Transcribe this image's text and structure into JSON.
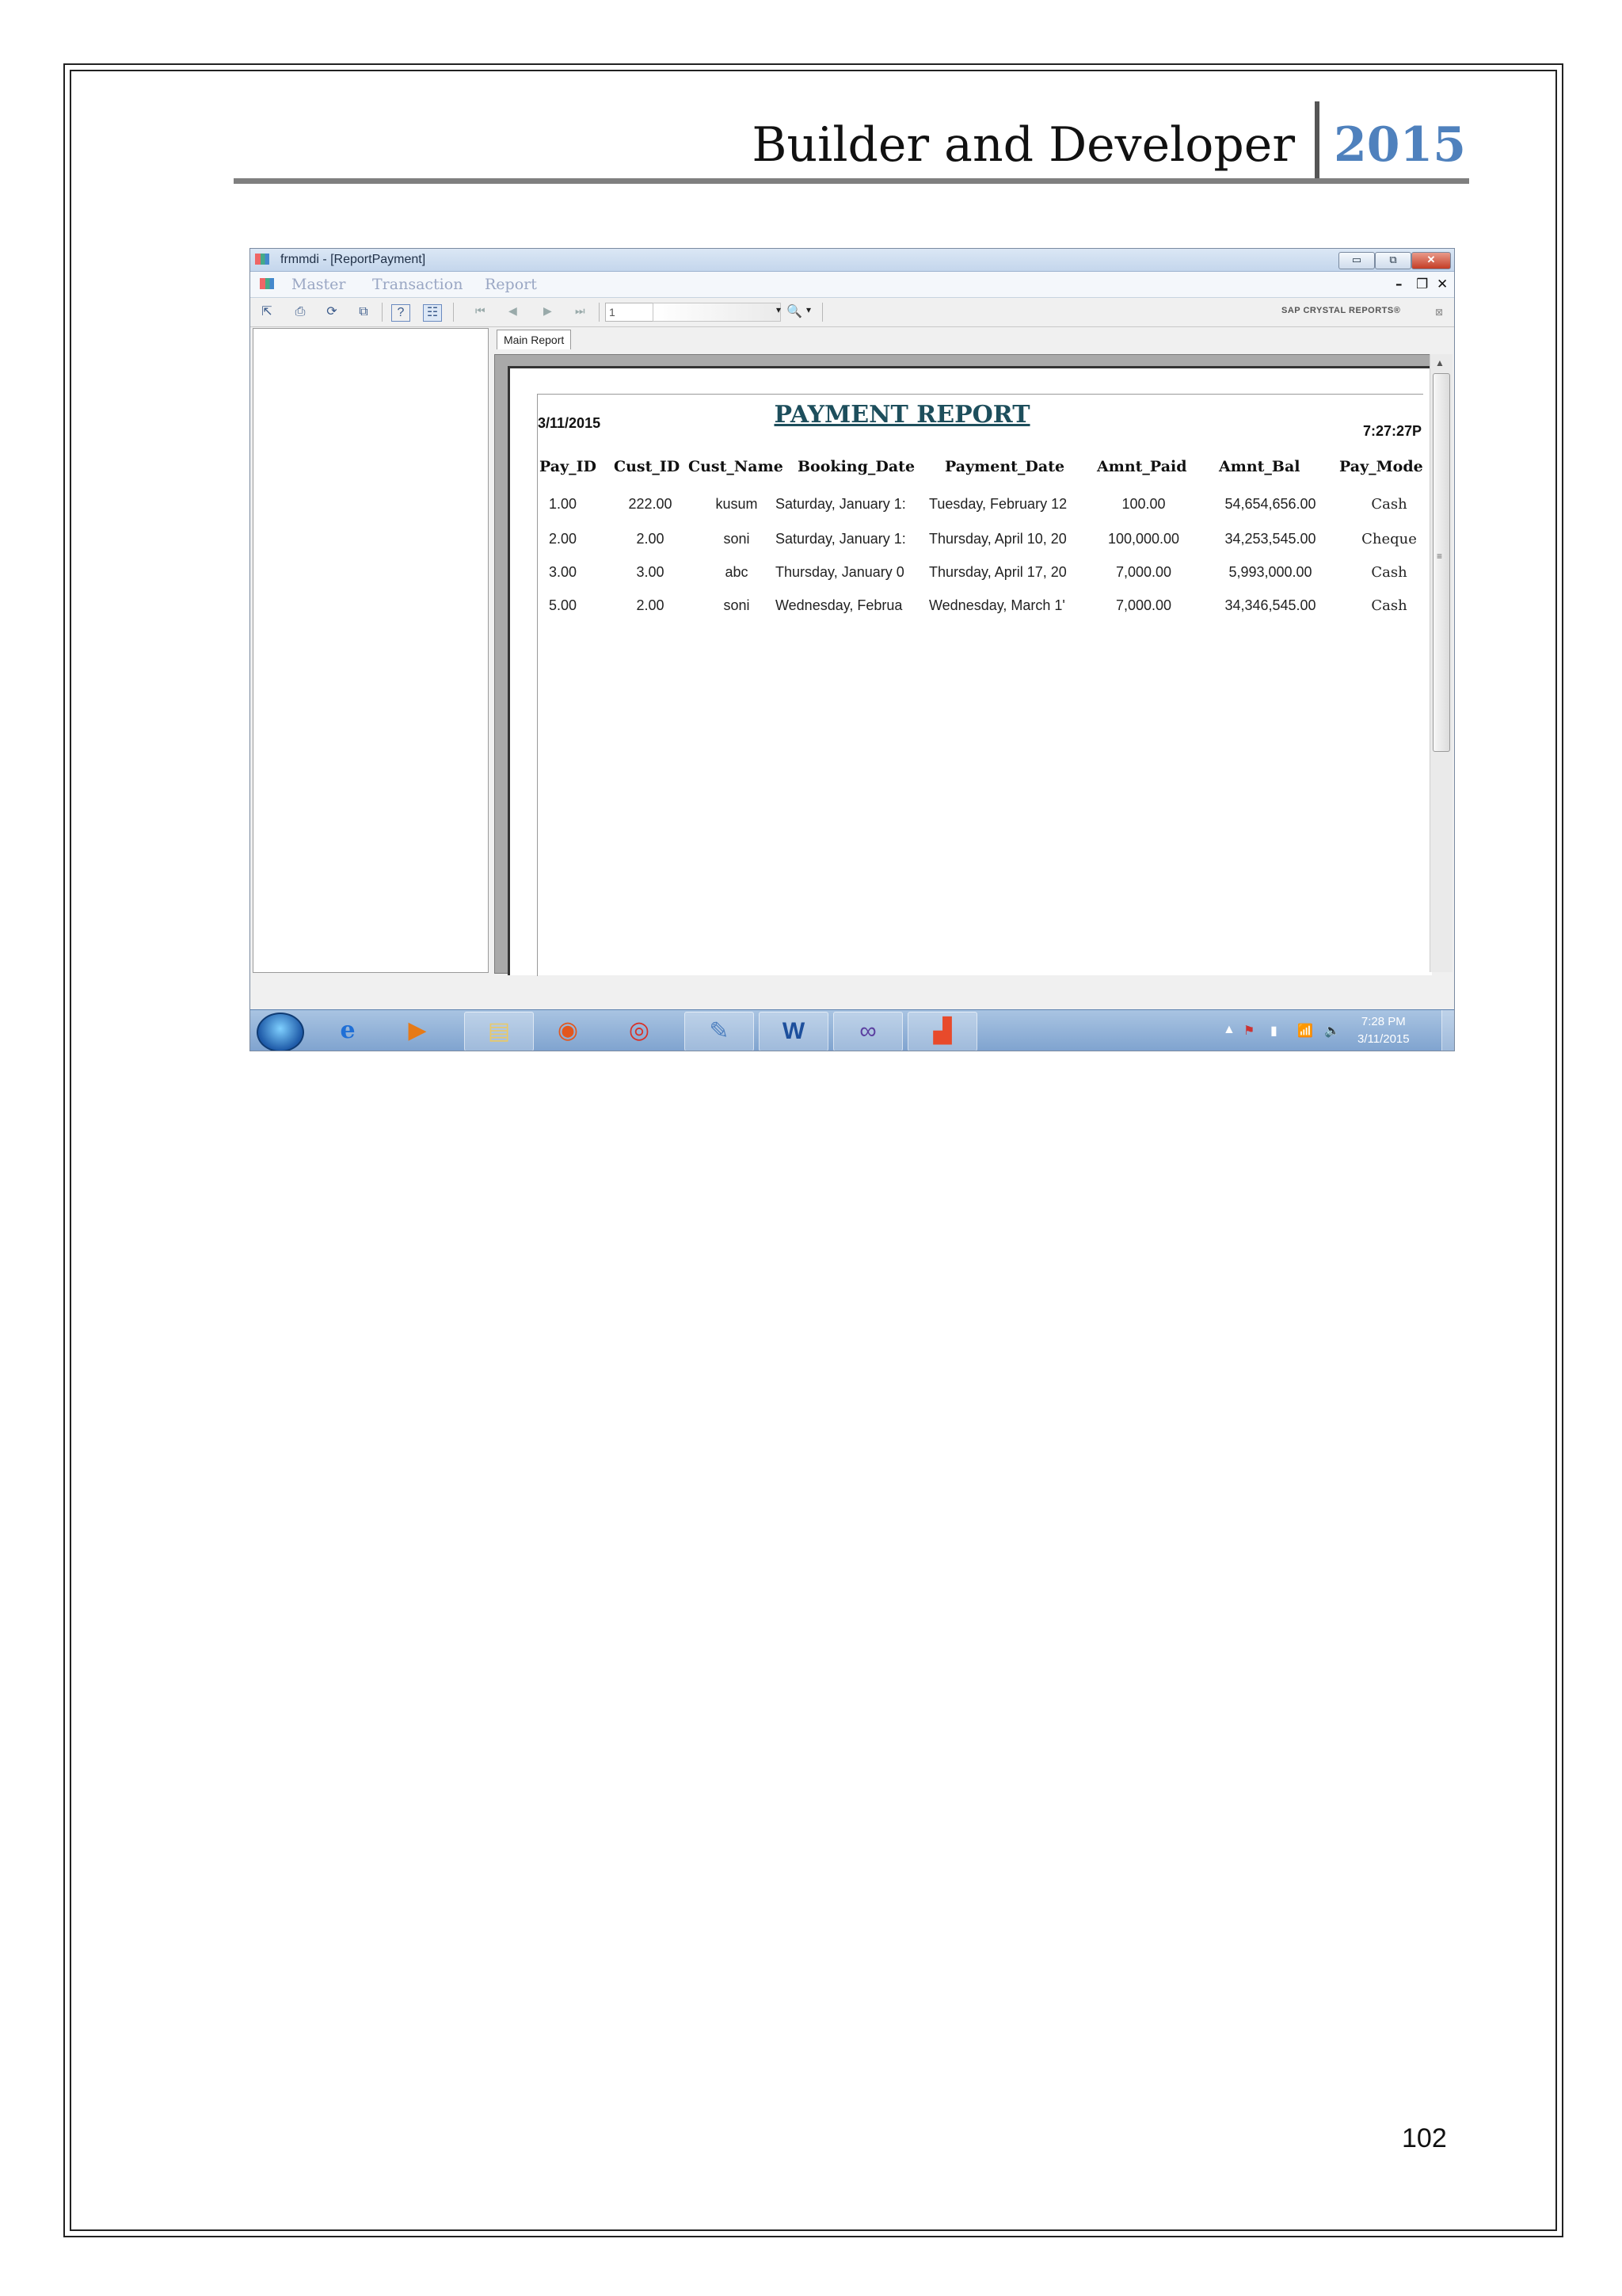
{
  "document": {
    "header_title": "Builder and Developer",
    "header_year": "2015",
    "page_number": "102"
  },
  "window": {
    "title": "frmmdi - [ReportPayment]",
    "controls": {
      "minimize": "▭",
      "maximize": "⧉",
      "close": "✕"
    },
    "mdi_controls": {
      "minimize": "–",
      "restore": "❐",
      "close": "✕"
    }
  },
  "menu": {
    "items": [
      "Master",
      "Transaction",
      "Report"
    ]
  },
  "toolbar": {
    "page_value": "1",
    "brand": "SAP CRYSTAL REPORTS®"
  },
  "tabs": {
    "main": "Main Report"
  },
  "report": {
    "title": "PAYMENT REPORT",
    "date": "3/11/2015",
    "time": "7:27:27P",
    "columns": [
      "Pay_ID",
      "Cust_ID",
      "Cust_Name",
      "Booking_Date",
      "Payment_Date",
      "Amnt_Paid",
      "Amnt_Bal",
      "Pay_Mode"
    ],
    "rows": [
      [
        "1.00",
        "222.00",
        "kusum",
        "Saturday, January 1:",
        "Tuesday, February 12",
        "100.00",
        "54,654,656.00",
        "Cash"
      ],
      [
        "2.00",
        "2.00",
        "soni",
        "Saturday, January 1:",
        "Thursday, April 10, 20",
        "100,000.00",
        "34,253,545.00",
        "Cheque"
      ],
      [
        "3.00",
        "3.00",
        "abc",
        "Thursday, January 0",
        "Thursday, April 17, 20",
        "7,000.00",
        "5,993,000.00",
        "Cash"
      ],
      [
        "5.00",
        "2.00",
        "soni",
        "Wednesday, Februa",
        "Wednesday, March 1'",
        "7,000.00",
        "34,346,545.00",
        "Cash"
      ]
    ]
  },
  "taskbar": {
    "time": "7:28 PM",
    "date": "3/11/2015",
    "apps": [
      "internet-explorer-icon",
      "media-player-icon",
      "file-explorer-icon",
      "firefox-icon",
      "chrome-icon",
      "paint-icon",
      "word-icon",
      "visual-studio-icon",
      "windows-app-icon"
    ]
  },
  "colors": {
    "year_blue": "#4f81bd",
    "report_title": "#1d4e5c",
    "taskbar": "#7fa3cf"
  }
}
